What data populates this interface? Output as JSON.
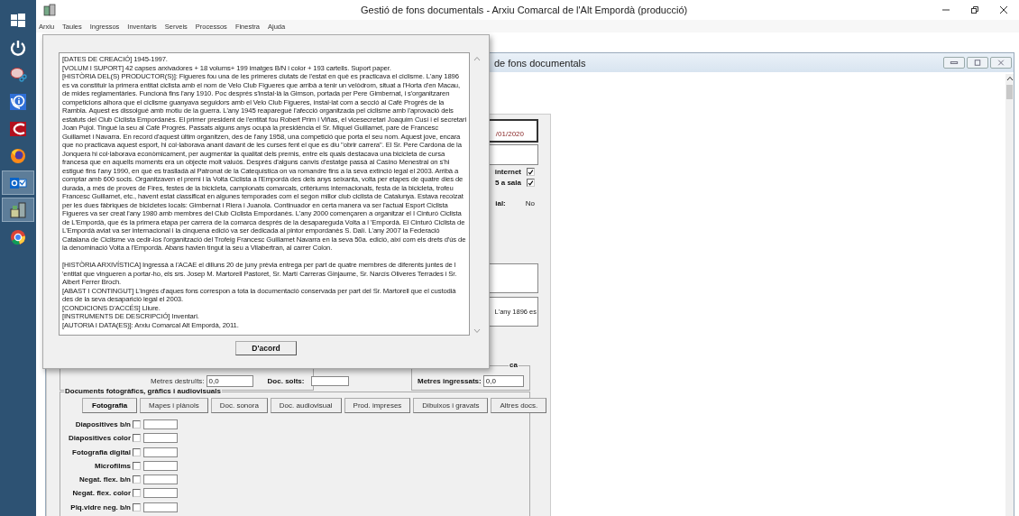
{
  "taskbar": {
    "items": [
      {
        "running": false
      },
      {
        "running": false
      },
      {
        "running": false
      },
      {
        "running": false
      },
      {
        "running": false
      },
      {
        "running": false
      },
      {
        "running": true
      },
      {
        "running": true
      },
      {
        "running": false
      }
    ]
  },
  "app": {
    "title": "Gestió de fons documentals - Arxiu Comarcal de l'Alt Empordà (producció)",
    "menu": [
      "Arxiu",
      "Taules",
      "Ingressos",
      "Inventaris",
      "Serveis",
      "Processos",
      "Finestra",
      "Ajuda"
    ]
  },
  "child_window": {
    "title": "de fons documentals"
  },
  "form": {
    "date": "/01/2020",
    "checks": [
      {
        "label": "internet",
        "checked": true
      },
      {
        "label": "5 a sala",
        "checked": true
      }
    ],
    "status_label": "ial:",
    "status_value": "No",
    "memo_preview": "L'any 1896 es",
    "destroyed": {
      "label": "Metres destruïts:",
      "value": "0,0"
    },
    "loose_docs_label": "Doc. solts:",
    "ingress": {
      "legend": "ca",
      "label": "Metres ingressats:",
      "value": "0,0"
    },
    "photo_group": {
      "legend": "Documents fotogràfics, gràfics i audiovisuals",
      "tabs": [
        {
          "label": "Fotografia",
          "selected": true
        },
        {
          "label": "Mapes i plànols",
          "selected": false
        },
        {
          "label": "Doc. sonora",
          "selected": false
        },
        {
          "label": "Doc. audiovisual",
          "selected": false
        },
        {
          "label": "Prod. impreses",
          "selected": false
        },
        {
          "label": "Dibuixos i gravats",
          "selected": false
        },
        {
          "label": "Altres docs.",
          "selected": false
        }
      ],
      "rows": [
        {
          "label": "Diapositives b/n",
          "checked": false
        },
        {
          "label": "Diapositives color",
          "checked": false
        },
        {
          "label": "Fotografia digital",
          "checked": false
        },
        {
          "label": "Microfilms",
          "checked": false
        },
        {
          "label": "Negat. flex. b/n",
          "checked": false
        },
        {
          "label": "Negat. flex. color",
          "checked": false
        },
        {
          "label": "Plq.vidre neg. b/n",
          "checked": false
        }
      ]
    }
  },
  "dialog": {
    "sections": [
      {
        "paragraphs": [
          "[DATES DE CREACIÓ] 1945-1997.",
          "[VOLUM I SUPORT] 42 capses arxivadores + 18 volums+ 199 imatges B/N i color + 193 cartells. Suport paper.",
          "[HISTÒRIA DEL(S) PRODUCTOR(S)]: Figueres fou una de les primeres ciutats de l'estat en què es practicava el ciclisme. L'any 1896 es va constituir la primera entitat ciclista amb el nom de Velo Club Figueres que arribà a tenir un velòdrom, situat a l'Horta d'en Macau, de mides reglamentàries. Funcionà fins l'any 1910. Poc després s'instal·là la Gimson, portada per Pere Gimbernat, i s'organitzaren competicions alhora que el ciclisme guanyava seguidors amb el Velo Club Figueres, instal·lat com a secció al Cafè Progrés de la Rambla. Aquest es dissolgué amb motiu de la guerra. L'any 1945 reaparegué l'afecció organitzada pel ciclisme amb l'aprovació dels estatuts del Club Ciclista Empordanès.  El primer president de l'entitat fou Robert Prim i Viñas, el vicesecretari Joaquim Cusí i el secretari Joan Pujol. Tingué la seu al Cafè Progrés. Passats alguns anys ocupà la presidència el Sr. Miquel Guillamet, pare de Francesc Guillamet i Navarra. En record d'aquest últim organitzen, des de l'any 1958, una competició que porta el seu nom. Aquest jove, encara que no practicava aquest esport, hi col·laborava anant davant de les curses fent el que es diu \"obrir carrera\". El Sr. Pere Cardona de la Jonquera hi col·laborava econòmicament, per augmentar la qualitat dels premis, entre els quals destacava una bicicleta de cursa francesa que en aquells moments era un objecte molt valuós. Després d'alguns canvis d'estatge passà al Casino Menestral on s'hi estigué fins l'any 1990, en què es traslladà al Patronat de la Catequística on va romandre fins a la seva extinció legal el 2003. Arribà a comptar amb 600 socis. Organitzaven el premi i la Volta Ciclista a l'Empordà des dels anys seixanta, volta per etapes de quatre dies de durada, a més de proves de Fires, festes de la bicicleta, campionats comarcals, critèriums internacionals, festa de la bicicleta, trofeu Francesc Guillamet, etc., havent estat classificat en algunes temporades com el segon millor club ciclista de Catalunya. Estava recolzat per les dues fàbriques de bicicletes locals: Gimbernat i Riera i Juanola. Continuador en certa manera va ser l'actual  Esport Ciclista Figueres va ser creat l'any 1980 amb membres del Club Ciclista Empordanès. L'any 2000 començaren a organitzar el I Cinturó Ciclista de L'Empordà, que és la primera etapa per carrera de la comarca després de la desapareguda Volta a l 'Empordà. El Cinturó Ciclista de L'Empordà aviat va ser internacional i la cinquena edició va ser dedicada al pintor empordanès S. Dalí. L'any 2007 la Federació Catalana de Ciclisme va cedir-los l'organització del Trofeig Francesc Guillamet Navarra en la seva 50a. edició, així com els drets d'ús de la denominació Volta a l'Empordà. Abans havien tingut la seu a Vilabertran, al carrer Colon."
        ]
      },
      {
        "paragraphs": [
          "[HISTÒRIA ARXIVÍSTICA] Ingressà a l'ACAE el dilluns 20 de juny prèvia entrega per part de quatre membres de diferents juntes de l 'entitat que vingueren a portar-ho, els srs. Josep M. Martorell Pastoret, Sr. Martí Carreras Ginjaume, Sr. Narcís Oliveres Terrades i Sr. Albert Ferrer Broch.",
          "[ABAST I CONTINGUT] L'ingrés d'aques fons correspon a tota la documentació conservada per part del Sr. Martorell que el custodià des de la seva desaparició legal el 2003.",
          "[CONDICIONS D'ACCÉS] Lliure.",
          "[INSTRUMENTS DE DESCRIPCIÓ] Inventari.",
          "[AUTORIA I DATA(ES)]: Arxiu Comarcal Alt Empordà, 2011."
        ]
      }
    ],
    "button": "D'acord"
  }
}
